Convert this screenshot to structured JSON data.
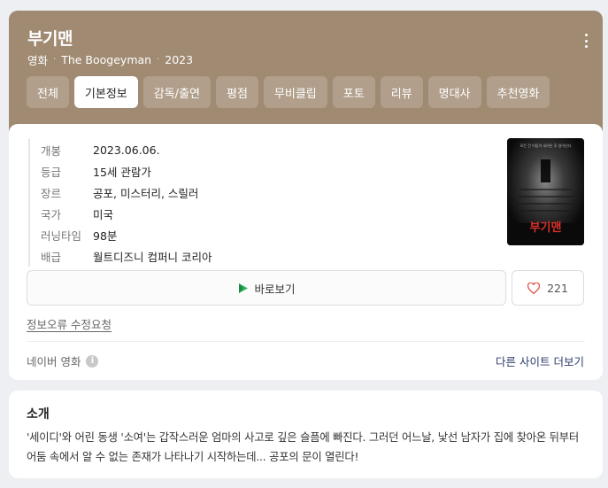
{
  "header": {
    "title": "부기맨",
    "meta": [
      "영화",
      "The Boogeyman",
      "2023"
    ],
    "meta_separator": "·"
  },
  "tabs": [
    {
      "label": "전체",
      "active": false
    },
    {
      "label": "기본정보",
      "active": true
    },
    {
      "label": "감독/출연",
      "active": false
    },
    {
      "label": "평점",
      "active": false
    },
    {
      "label": "무비클립",
      "active": false
    },
    {
      "label": "포토",
      "active": false
    },
    {
      "label": "리뷰",
      "active": false
    },
    {
      "label": "명대사",
      "active": false
    },
    {
      "label": "추천영화",
      "active": false
    }
  ],
  "info": [
    {
      "key": "개봉",
      "value": "2023.06.06."
    },
    {
      "key": "등급",
      "value": "15세 관람가"
    },
    {
      "key": "장르",
      "value": "공포, 미스터리, 스릴러"
    },
    {
      "key": "국가",
      "value": "미국"
    },
    {
      "key": "러닝타임",
      "value": "98분"
    },
    {
      "key": "배급",
      "value": "월트디즈니 컴퍼니 코리아"
    }
  ],
  "poster": {
    "tagline": "모든 건 어둠이 내려온 후 일어난다",
    "title": "부기맨"
  },
  "actions": {
    "watch_label": "바로보기",
    "like_count": "221"
  },
  "report_label": "정보오류 수정요청",
  "source_label": "네이버 영화",
  "info_icon": "i",
  "other_sites_label": "다른 사이트 더보기",
  "intro": {
    "heading": "소개",
    "text": "'세이디'와 어린 동생 '소여'는 갑작스러운 엄마의 사고로 깊은 슬픔에 빠진다. 그러던 어느날, 낯선 남자가 집에 찾아온 뒤부터 어둠 속에서 알 수 없는 존재가 나타나기 시작하는데... 공포의 문이 열린다!"
  },
  "colors": {
    "hero_bg": "#a08a72",
    "link": "#2c3c6c",
    "poster_title": "#d9302a",
    "play_green": "#2fb55a"
  }
}
